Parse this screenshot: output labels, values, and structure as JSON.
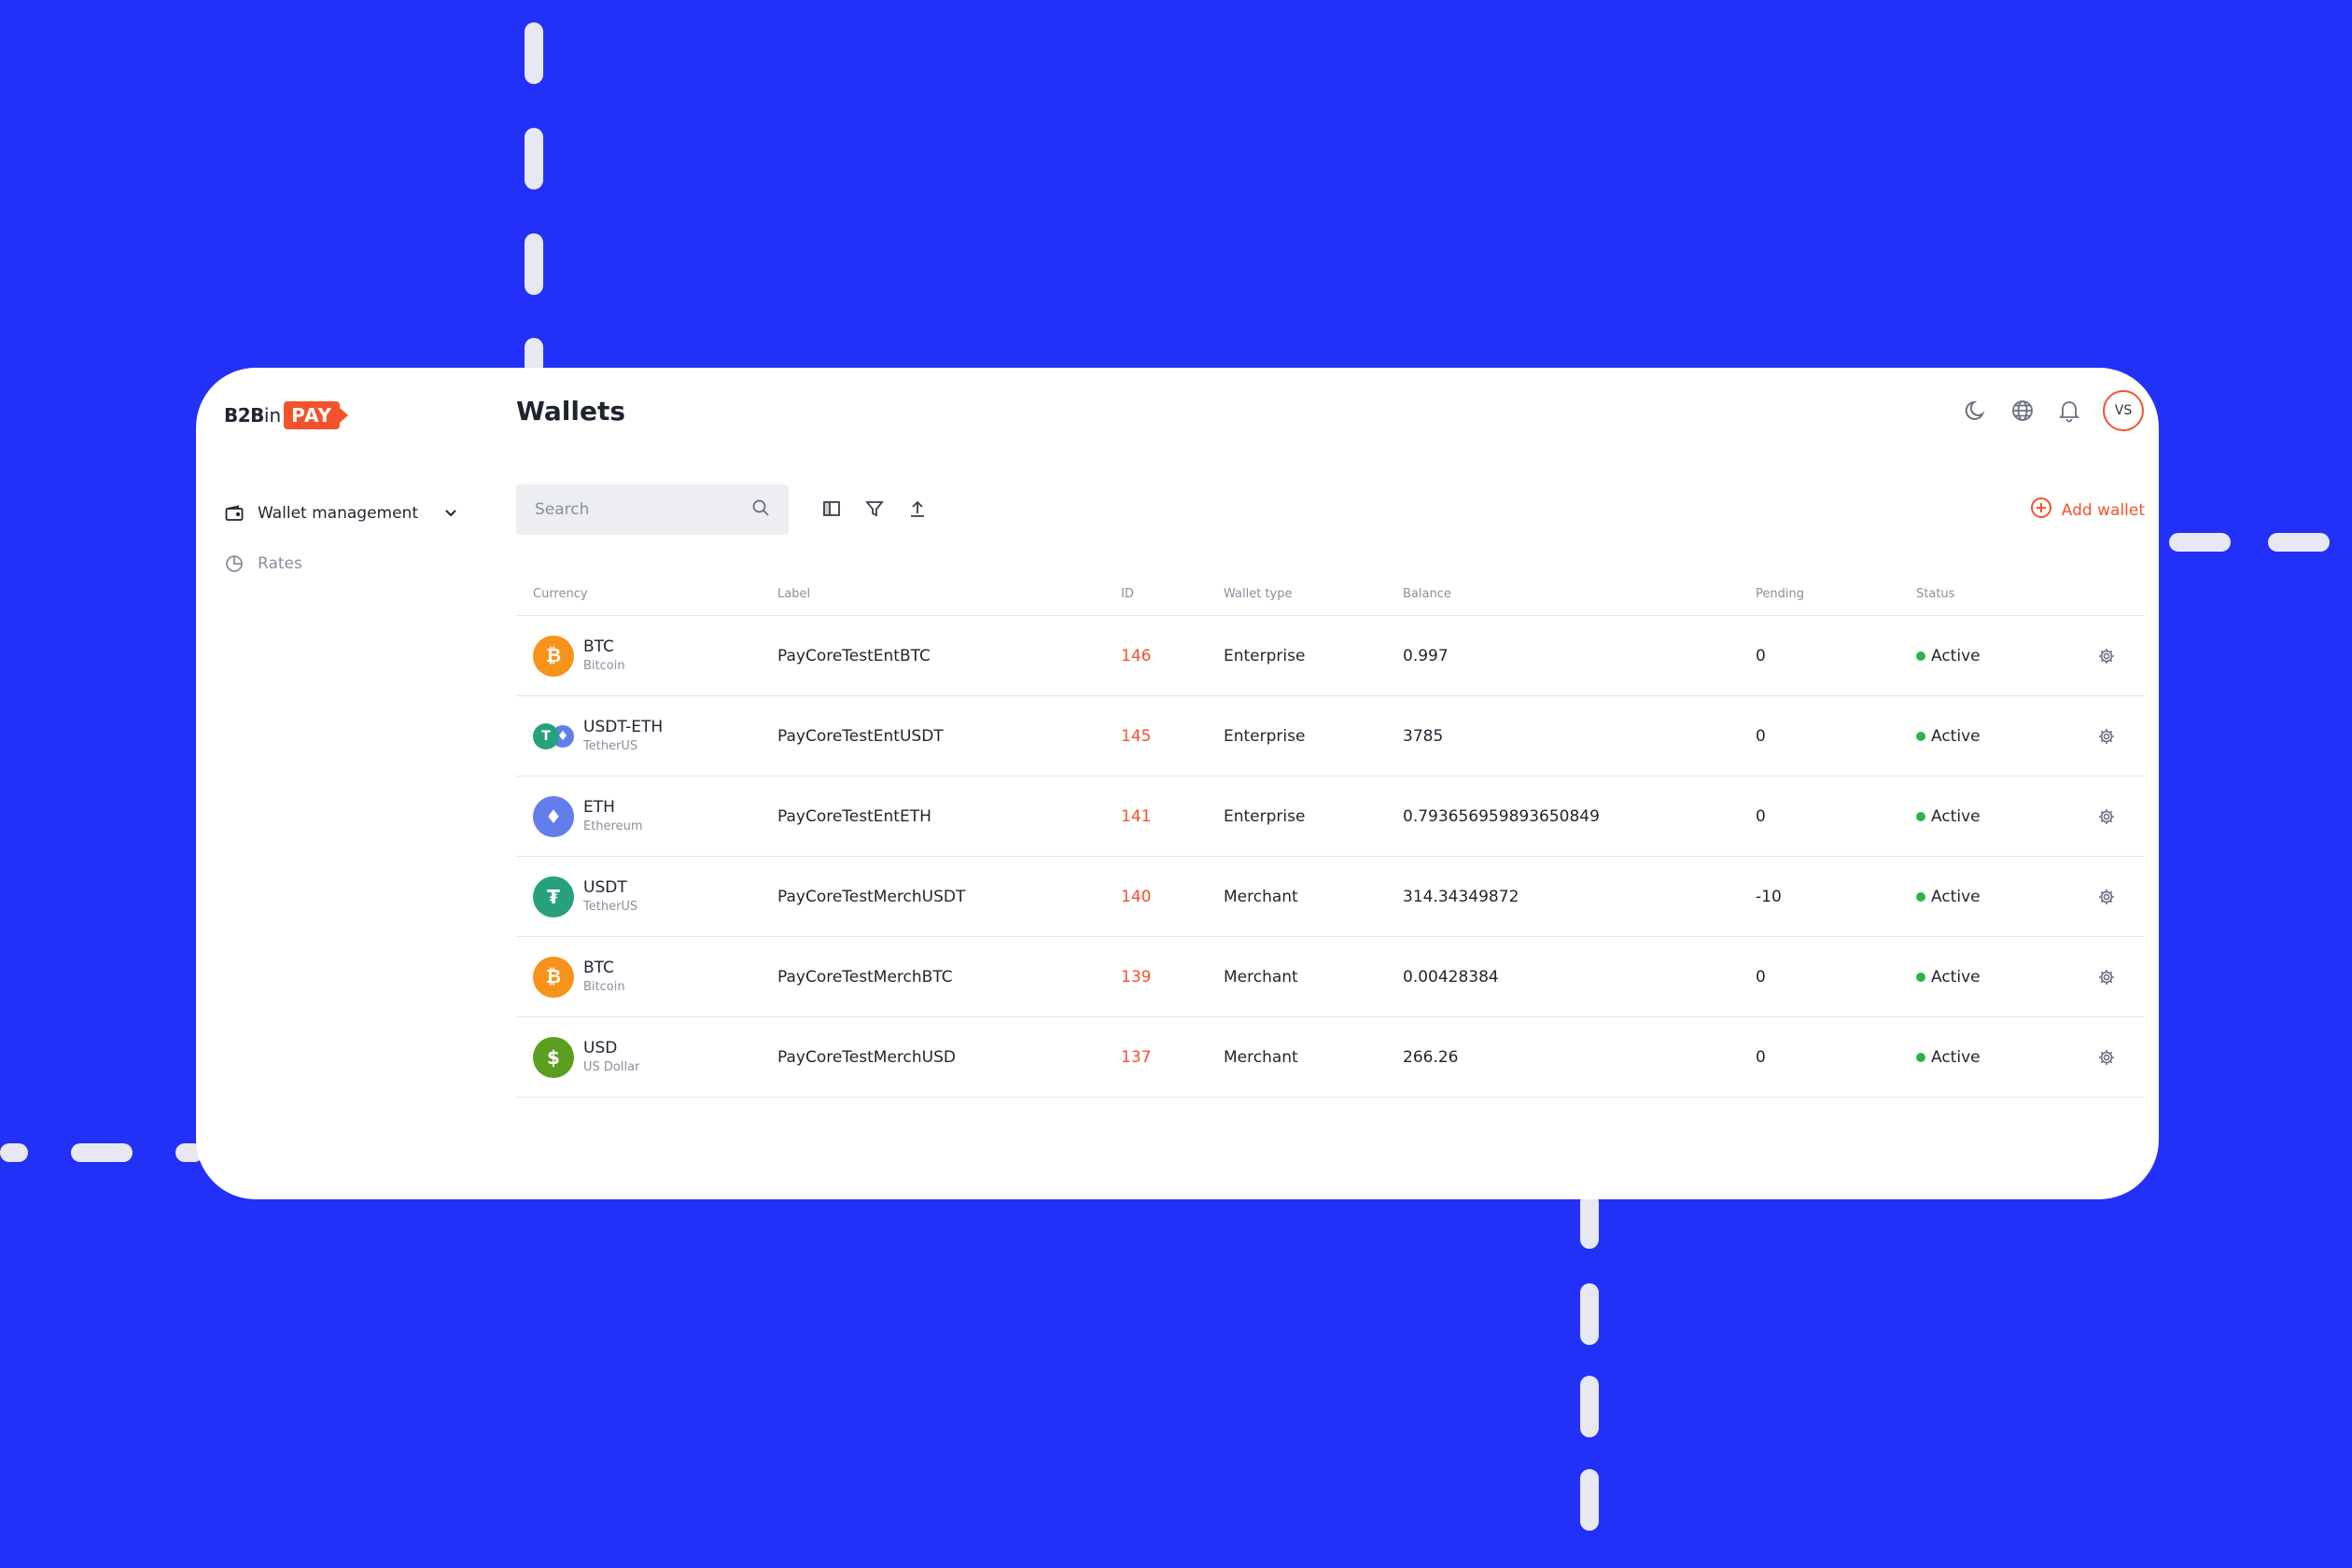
{
  "brand": {
    "b2b": "B2B",
    "in": "in",
    "pay": "PAY"
  },
  "colors": {
    "accent": "#f4522d",
    "background": "#2330f7",
    "active": "#2bb34b"
  },
  "sidebar": {
    "items": [
      {
        "label": "Wallet management",
        "icon": "wallet-icon"
      },
      {
        "label": "Rates",
        "icon": "pie-chart-icon"
      }
    ]
  },
  "header": {
    "title": "Wallets",
    "avatar_initials": "VS",
    "icons": [
      "moon-icon",
      "globe-icon",
      "bell-icon"
    ]
  },
  "toolbar": {
    "search_placeholder": "Search",
    "add_wallet_label": "Add wallet"
  },
  "table": {
    "columns": [
      "Currency",
      "Label",
      "ID",
      "Wallet type",
      "Balance",
      "Pending",
      "Status"
    ],
    "rows": [
      {
        "symbol": "BTC",
        "name": "Bitcoin",
        "label": "PayCoreTestEntBTC",
        "id": "146",
        "type": "Enterprise",
        "balance": "0.997",
        "pending": "0",
        "status": "Active",
        "coin": "btc"
      },
      {
        "symbol": "USDT-ETH",
        "name": "TetherUS",
        "label": "PayCoreTestEntUSDT",
        "id": "145",
        "type": "Enterprise",
        "balance": "3785",
        "pending": "0",
        "status": "Active",
        "coin": "usdt-eth"
      },
      {
        "symbol": "ETH",
        "name": "Ethereum",
        "label": "PayCoreTestEntETH",
        "id": "141",
        "type": "Enterprise",
        "balance": "0.793656959893650849",
        "pending": "0",
        "status": "Active",
        "coin": "eth"
      },
      {
        "symbol": "USDT",
        "name": "TetherUS",
        "label": "PayCoreTestMerchUSDT",
        "id": "140",
        "type": "Merchant",
        "balance": "314.34349872",
        "pending": "-10",
        "status": "Active",
        "coin": "usdt"
      },
      {
        "symbol": "BTC",
        "name": "Bitcoin",
        "label": "PayCoreTestMerchBTC",
        "id": "139",
        "type": "Merchant",
        "balance": "0.00428384",
        "pending": "0",
        "status": "Active",
        "coin": "btc"
      },
      {
        "symbol": "USD",
        "name": "US Dollar",
        "label": "PayCoreTestMerchUSD",
        "id": "137",
        "type": "Merchant",
        "balance": "266.26",
        "pending": "0",
        "status": "Active",
        "coin": "usd"
      }
    ]
  }
}
